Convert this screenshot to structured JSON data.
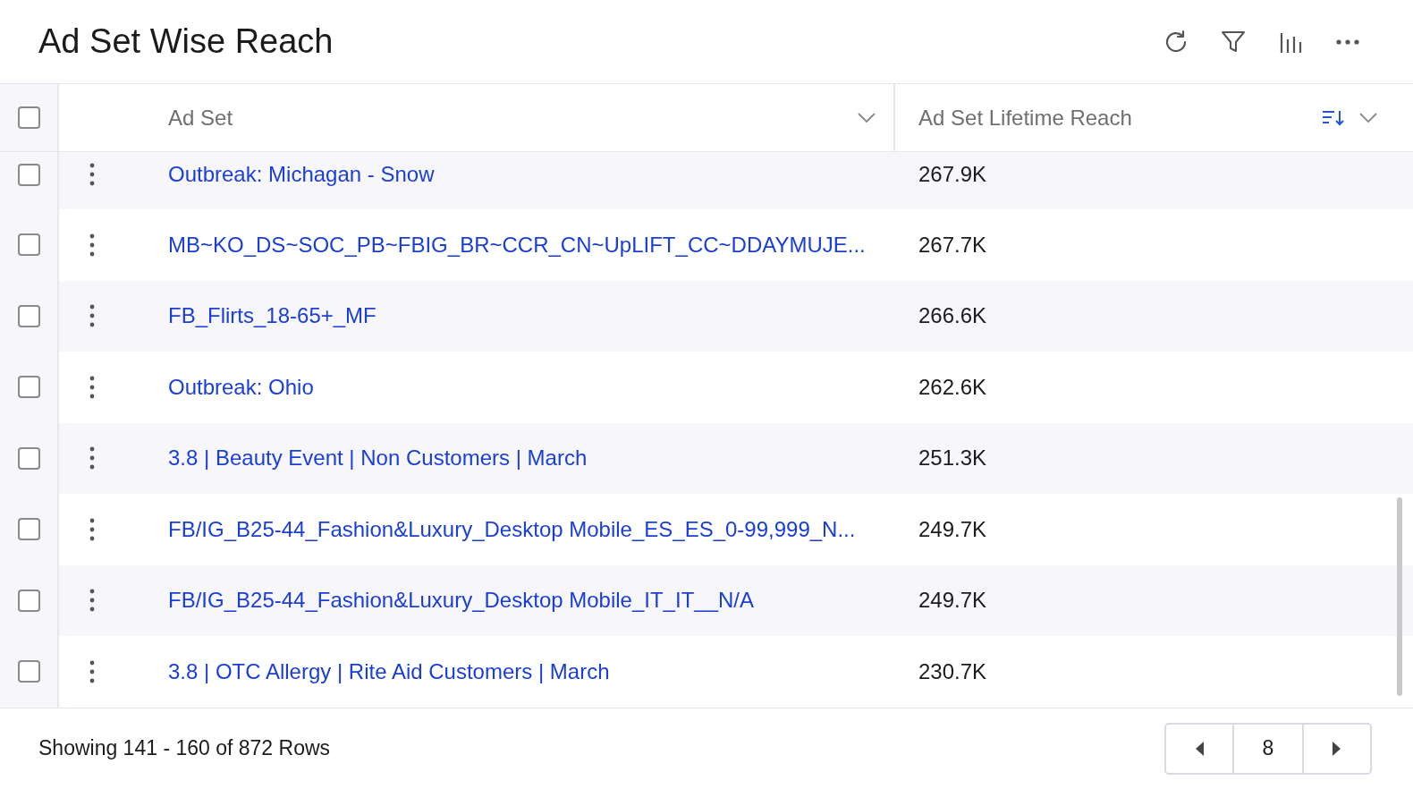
{
  "title": "Ad Set Wise Reach",
  "table": {
    "select_all_checked": false,
    "columns": [
      {
        "label": "Ad Set"
      },
      {
        "label": "Ad Set Lifetime Reach",
        "sorted": true
      }
    ],
    "rows": [
      {
        "ad_set": "Outbreak: Michagan - Snow",
        "reach": "267.9K",
        "checked": false
      },
      {
        "ad_set": "MB~KO_DS~SOC_PB~FBIG_BR~CCR_CN~UpLIFT_CC~DDAYMUJE...",
        "reach": "267.7K",
        "checked": false
      },
      {
        "ad_set": "FB_Flirts_18-65+_MF",
        "reach": "266.6K",
        "checked": false
      },
      {
        "ad_set": "Outbreak: Ohio",
        "reach": "262.6K",
        "checked": false
      },
      {
        "ad_set": "3.8 | Beauty Event | Non Customers | March",
        "reach": "251.3K",
        "checked": false
      },
      {
        "ad_set": "FB/IG_B25-44_Fashion&Luxury_Desktop Mobile_ES_ES_0-99,999_N...",
        "reach": "249.7K",
        "checked": false
      },
      {
        "ad_set": "FB/IG_B25-44_Fashion&Luxury_Desktop Mobile_IT_IT__N/A",
        "reach": "249.7K",
        "checked": false
      },
      {
        "ad_set": "3.8 | OTC Allergy | Rite Aid Customers | March",
        "reach": "230.7K",
        "checked": false
      }
    ]
  },
  "footer": {
    "summary": "Showing 141 - 160 of 872 Rows",
    "page": "8"
  }
}
